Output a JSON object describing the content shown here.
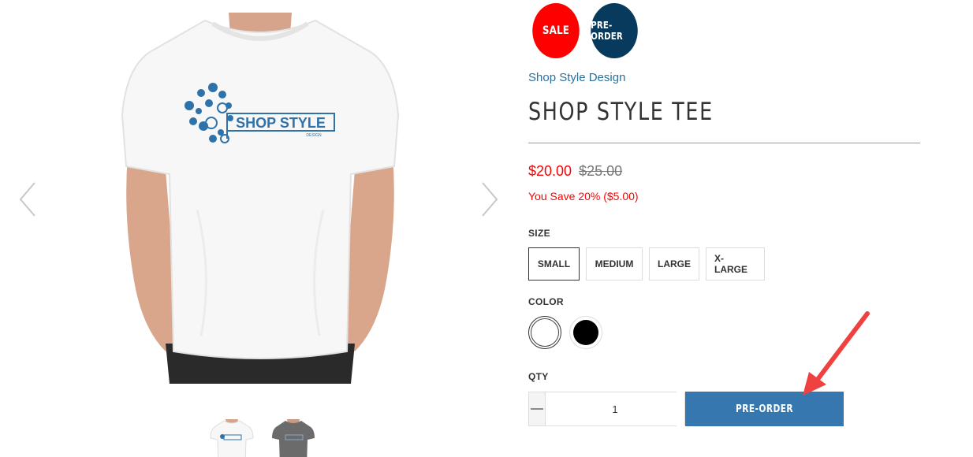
{
  "gallery": {
    "prev_icon": "chevron-left-icon",
    "next_icon": "chevron-right-icon",
    "main_image": {
      "subject": "model wearing white t-shirt",
      "logo_text": "SHOP STYLE",
      "logo_subtext": "DESIGN",
      "shirt_color": "#f7f7f7",
      "logo_color": "#2f72aa"
    },
    "thumbnails": [
      {
        "shirt_color": "#ffffff"
      },
      {
        "shirt_color": "#6b6b6b"
      }
    ]
  },
  "product": {
    "badges": [
      {
        "label": "SALE",
        "color": "#ff0000"
      },
      {
        "label": "PRE-ORDER",
        "color": "#073a5c"
      }
    ],
    "vendor": "Shop Style Design",
    "title": "SHOP STYLE TEE",
    "price": "$20.00",
    "compare_price": "$25.00",
    "savings": "You Save 20% ($5.00)",
    "size": {
      "label": "SIZE",
      "options": [
        "SMALL",
        "MEDIUM",
        "LARGE",
        "X-LARGE"
      ],
      "selected": "SMALL"
    },
    "color": {
      "label": "COLOR",
      "options": [
        {
          "name": "White",
          "hex": "#ffffff"
        },
        {
          "name": "Black",
          "hex": "#000000"
        }
      ],
      "selected": "White"
    },
    "qty": {
      "label": "QTY",
      "value": "1",
      "minus_icon": "minus-icon",
      "plus_icon": "plus-icon"
    },
    "cta_label": "PRE-ORDER"
  },
  "annotation": {
    "icon": "red-arrow-icon",
    "color": "#f04141"
  }
}
